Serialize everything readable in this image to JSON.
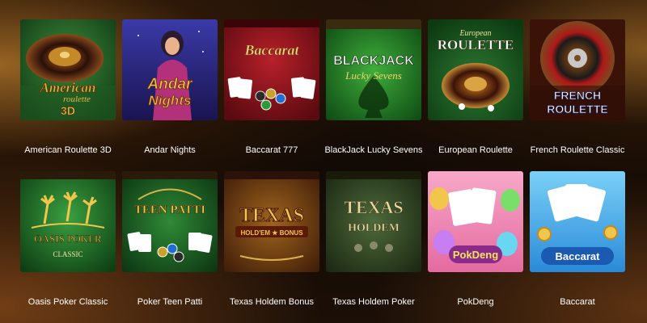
{
  "games": [
    {
      "title": "American Roulette 3D",
      "art": {
        "line1": "American",
        "line2": "roulette",
        "line3": "3D"
      }
    },
    {
      "title": "Andar Nights",
      "art": {
        "line1": "Andar",
        "line2": "Nights"
      }
    },
    {
      "title": "Baccarat 777",
      "art": {
        "line1": "Baccarat"
      }
    },
    {
      "title": "BlackJack Lucky Sevens",
      "art": {
        "line1": "BLACKJACK",
        "line2": "Lucky Sevens"
      }
    },
    {
      "title": "European Roulette",
      "art": {
        "line1": "European",
        "line2": "ROULETTE"
      }
    },
    {
      "title": "French Roulette Classic",
      "art": {
        "line1": "FRENCH",
        "line2": "ROULETTE"
      }
    },
    {
      "title": "Oasis Poker Classic",
      "art": {
        "line1": "OASIS POKER",
        "line2": "CLASSIC"
      }
    },
    {
      "title": "Poker Teen Patti",
      "art": {
        "line1": "TEEN PATTI"
      }
    },
    {
      "title": "Texas Holdem Bonus",
      "art": {
        "line1": "TEXAS",
        "line2": "HOLD'EM ★ BONUS"
      }
    },
    {
      "title": "Texas Holdem Poker",
      "art": {
        "line1": "TEXAS",
        "line2": "HOLDEM"
      }
    },
    {
      "title": "PokDeng",
      "art": {
        "line1": "PokDeng"
      }
    },
    {
      "title": "Baccarat",
      "art": {
        "line1": "Baccarat"
      }
    }
  ]
}
